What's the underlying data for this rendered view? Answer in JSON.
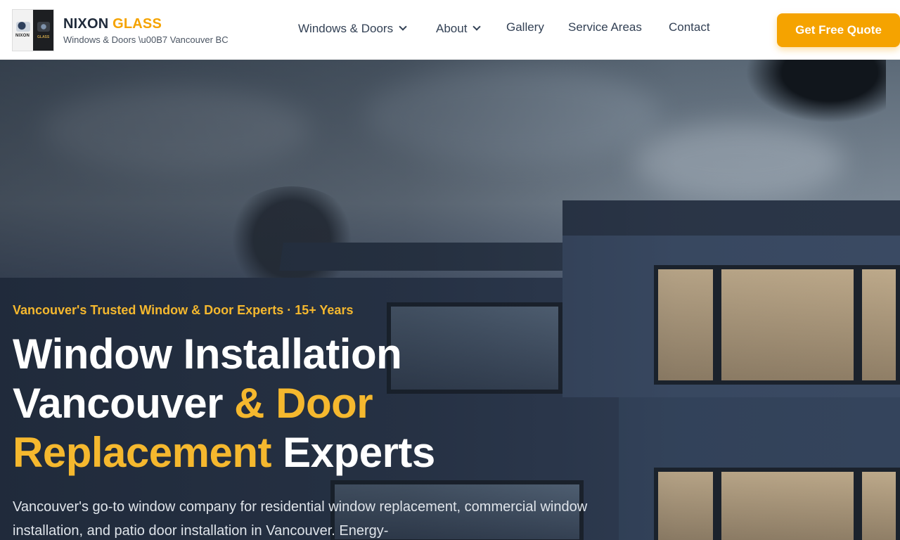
{
  "header": {
    "brand_primary": "NIXON",
    "brand_accent": "GLASS",
    "tagline": "Windows & Doors \\u00B7 Vancouver BC",
    "logo_text_left": "NIXON",
    "logo_text_right": "GLASS",
    "cta_label": "Get Free Quote"
  },
  "nav": {
    "items": [
      {
        "label": "Windows & Doors",
        "has_dropdown": true
      },
      {
        "label": "About",
        "has_dropdown": true
      },
      {
        "label": "Gallery",
        "has_dropdown": false
      },
      {
        "label": "Service Areas",
        "has_dropdown": false
      },
      {
        "label": "Contact",
        "has_dropdown": false
      }
    ]
  },
  "hero": {
    "eyebrow": "Vancouver's Trusted Window & Door Experts · 15+ Years",
    "headline_line1": "Window Installation",
    "headline_line2_white": "Vancouver ",
    "headline_line2_accent": "& Door",
    "headline_line3_accent": "Replacement",
    "headline_line3_white": " Experts",
    "lead": "Vancouver's go-to window company for residential window replacement, commercial window installation, and patio door installation in Vancouver. Energy-"
  },
  "colors": {
    "accent": "#f5a300",
    "accent_text": "#f5b82e",
    "brand_dark": "#1f2a3a"
  },
  "icons": {
    "dropdown": "chevron-down-icon",
    "logo": "nixon-glass-logo"
  }
}
